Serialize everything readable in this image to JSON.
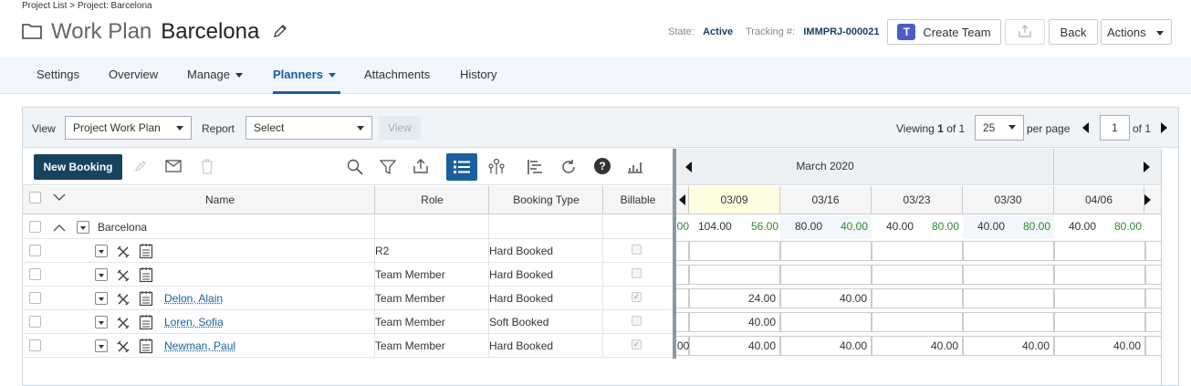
{
  "breadcrumb": "Project List > Project: Barcelona",
  "header": {
    "kind": "Work Plan",
    "name": "Barcelona",
    "state_label": "State:",
    "state_value": "Active",
    "tracking_label": "Tracking #:",
    "tracking_value": "IMMPRJ-000021",
    "create_team": "Create Team",
    "back": "Back",
    "actions": "Actions"
  },
  "nav": [
    "Settings",
    "Overview",
    "Manage",
    "Planners",
    "Attachments",
    "History"
  ],
  "toolbar": {
    "view_label": "View",
    "view_value": "Project Work Plan",
    "report_label": "Report",
    "report_value": "Select",
    "view_button": "View",
    "viewing_prefix": "Viewing",
    "viewing_current": "1",
    "viewing_suffix": "of 1",
    "per_page_value": "25",
    "per_page_label": "per page",
    "page_value": "1",
    "page_of": "of 1",
    "new_booking": "New Booking"
  },
  "grid": {
    "columns": [
      "Name",
      "Role",
      "Booking Type",
      "Billable"
    ],
    "group": "Barcelona",
    "rows": [
      {
        "name": "",
        "role": "R2",
        "type": "Hard Booked",
        "billable": false,
        "weeks": [
          "",
          "",
          "",
          "",
          ""
        ]
      },
      {
        "name": "",
        "role": "Team Member",
        "type": "Hard Booked",
        "billable": false,
        "weeks": [
          "",
          "",
          "",
          "",
          ""
        ]
      },
      {
        "name": "Delon, Alain",
        "role": "Team Member",
        "type": "Hard Booked",
        "billable": true,
        "weeks": [
          "24.00",
          "40.00",
          "",
          "",
          ""
        ]
      },
      {
        "name": "Loren, Sofia",
        "role": "Team Member",
        "type": "Soft Booked",
        "billable": false,
        "weeks": [
          "40.00",
          "",
          "",
          "",
          ""
        ]
      },
      {
        "name": "Newman, Paul",
        "role": "Team Member",
        "type": "Hard Booked",
        "billable": true,
        "weeks": [
          "40.00",
          "40.00",
          "40.00",
          "40.00",
          "40.00"
        ]
      }
    ]
  },
  "timeline": {
    "month": "March 2020",
    "weeks": [
      "03/09",
      "03/16",
      "03/23",
      "03/30",
      "04/06"
    ],
    "left_partial_total": "00",
    "totals": [
      {
        "a": "104.00",
        "b": "56.00"
      },
      {
        "a": "80.00",
        "b": "40.00"
      },
      {
        "a": "40.00",
        "b": "80.00"
      },
      {
        "a": "40.00",
        "b": "80.00"
      },
      {
        "a": "40.00",
        "b": "80.00"
      }
    ],
    "newman_partial": "00"
  },
  "colors": {
    "accent": "#1a5f9e",
    "new_booking_bg": "#17435e",
    "green": "#2e8b2e",
    "today_bg": "#fffde0"
  }
}
